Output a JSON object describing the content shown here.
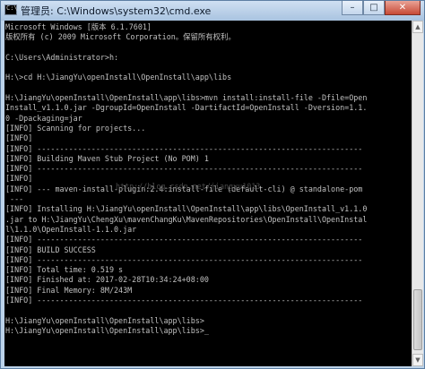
{
  "window": {
    "title": "管理员: C:\\Windows\\system32\\cmd.exe",
    "controls": {
      "minimize": "–",
      "maximize": "□",
      "close": "✕"
    }
  },
  "console": {
    "lines": [
      "Microsoft Windows [版本 6.1.7601]",
      "版权所有 (c) 2009 Microsoft Corporation。保留所有权利。",
      "",
      "C:\\Users\\Administrator>h:",
      "",
      "H:\\>cd H:\\JiangYu\\openInstall\\OpenInstall\\app\\libs",
      "",
      "H:\\JiangYu\\openInstall\\OpenInstall\\app\\libs>mvn install:install-file -Dfile=Open",
      "Install_v1.1.0.jar -DgroupId=OpenInstall -DartifactId=OpenInstall -Dversion=1.1.",
      "0 -Dpackaging=jar",
      "[INFO] Scanning for projects...",
      "[INFO]",
      "[INFO] ------------------------------------------------------------------------",
      "[INFO] Building Maven Stub Project (No POM) 1",
      "[INFO] ------------------------------------------------------------------------",
      "[INFO]",
      "[INFO] --- maven-install-plugin:2.4:install-file (default-cli) @ standalone-pom",
      " ---",
      "[INFO] Installing H:\\JiangYu\\openInstall\\OpenInstall\\app\\libs\\OpenInstall_v1.1.0",
      ".jar to H:\\JiangYu\\ChengXu\\mavenChangKu\\MavenRepositories\\OpenInstall\\OpenInstal",
      "l\\1.1.0\\OpenInstall-1.1.0.jar",
      "[INFO] ------------------------------------------------------------------------",
      "[INFO] BUILD SUCCESS",
      "[INFO] ------------------------------------------------------------------------",
      "[INFO] Total time: 0.519 s",
      "[INFO] Finished at: 2017-02-28T10:34:24+08:00",
      "[INFO] Final Memory: 8M/243M",
      "[INFO] ------------------------------------------------------------------------",
      "",
      "H:\\JiangYu\\openInstall\\OpenInstall\\app\\libs>",
      "H:\\JiangYu\\openInstall\\OpenInstall\\app\\libs>_"
    ],
    "watermark": "http://blog.csdn.net/jiangyu1013"
  },
  "colors": {
    "console_background": "#000000",
    "console_text": "#c0c0c0",
    "titlebar": "#bcd3ea",
    "close_button": "#c74a36"
  },
  "icons": {
    "app_icon": "cmd-console-icon",
    "scroll_up": "arrow-up-icon",
    "scroll_down": "arrow-down-icon"
  }
}
